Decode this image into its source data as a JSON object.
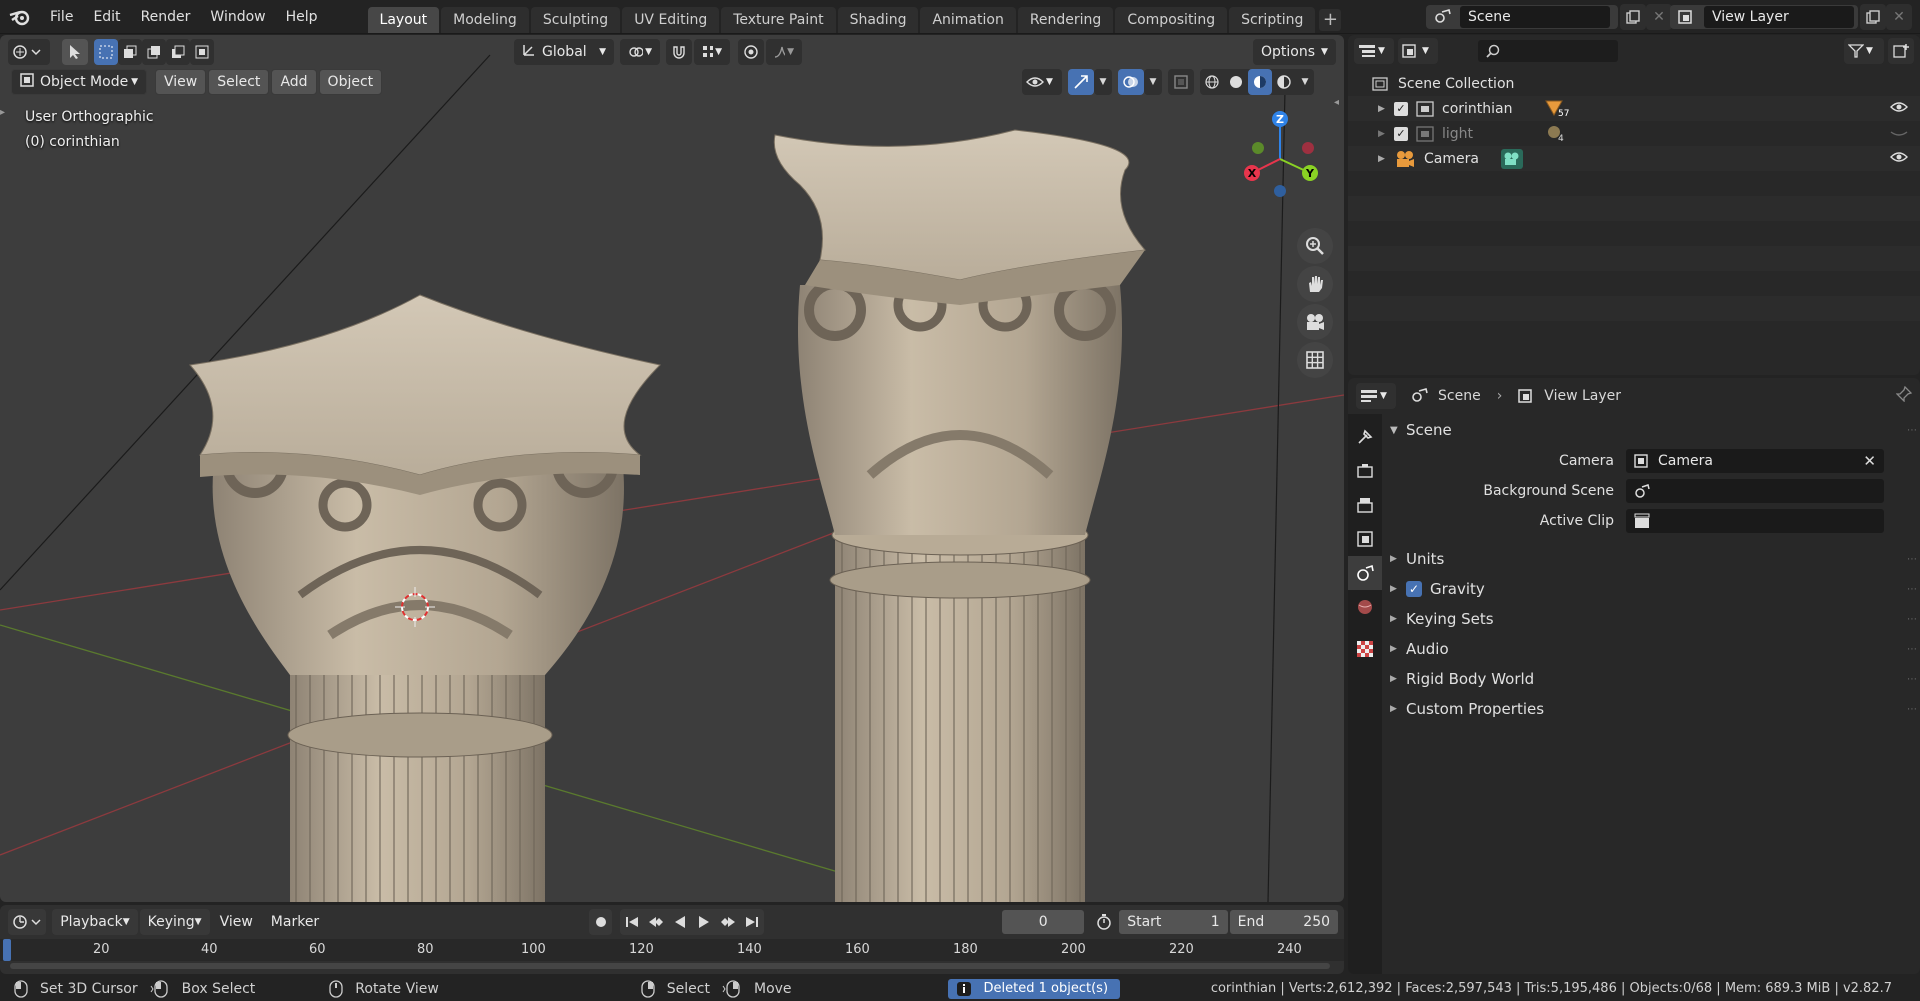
{
  "menu": [
    "File",
    "Edit",
    "Render",
    "Window",
    "Help"
  ],
  "workspaces": [
    "Layout",
    "Modeling",
    "Sculpting",
    "UV Editing",
    "Texture Paint",
    "Shading",
    "Animation",
    "Rendering",
    "Compositing",
    "Scripting"
  ],
  "active_workspace": "Layout",
  "scene_name": "Scene",
  "view_layer_name": "View Layer",
  "viewport": {
    "mode": "Object Mode",
    "menus": [
      "View",
      "Select",
      "Add",
      "Object"
    ],
    "transform_orientation": "Global",
    "options_label": "Options",
    "view_name": "User Orthographic",
    "active_object": "(0) corinthian",
    "gizmo": {
      "x": "X",
      "y": "Y",
      "z": "Z"
    }
  },
  "outliner": {
    "root": "Scene Collection",
    "items": [
      {
        "name": "corinthian",
        "badge": "57"
      },
      {
        "name": "light",
        "badge": "4"
      },
      {
        "name": "Camera",
        "badge": ""
      }
    ]
  },
  "properties": {
    "breadcrumb_scene": "Scene",
    "breadcrumb_layer": "View Layer",
    "panel_title": "Scene",
    "camera_label": "Camera",
    "camera_value": "Camera",
    "background_scene_label": "Background Scene",
    "active_clip_label": "Active Clip",
    "subpanels": [
      "Units",
      "Gravity",
      "Keying Sets",
      "Audio",
      "Rigid Body World",
      "Custom Properties"
    ]
  },
  "timeline": {
    "menus": [
      "Playback",
      "Keying",
      "View",
      "Marker"
    ],
    "current_frame": "0",
    "start_label": "Start",
    "start_value": "1",
    "end_label": "End",
    "end_value": "250",
    "ruler": [
      "20",
      "40",
      "60",
      "80",
      "100",
      "120",
      "140",
      "160",
      "180",
      "200",
      "220",
      "240"
    ]
  },
  "statusbar": {
    "set_cursor": "Set 3D Cursor",
    "box_select": "Box Select",
    "rotate_view": "Rotate View",
    "select": "Select",
    "move": "Move",
    "message": "Deleted 1 object(s)",
    "stats": "corinthian | Verts:2,612,392 | Faces:2,597,543 | Tris:5,195,486 | Objects:0/68 | Mem: 689.3 MiB | v2.82.7"
  },
  "colors": {
    "accent": "#4772b3",
    "bg": "#232323",
    "viewport": "#3d3d3d",
    "x_axis": "#e8354c",
    "y_axis": "#8ad224",
    "z_axis": "#2f83e8"
  }
}
